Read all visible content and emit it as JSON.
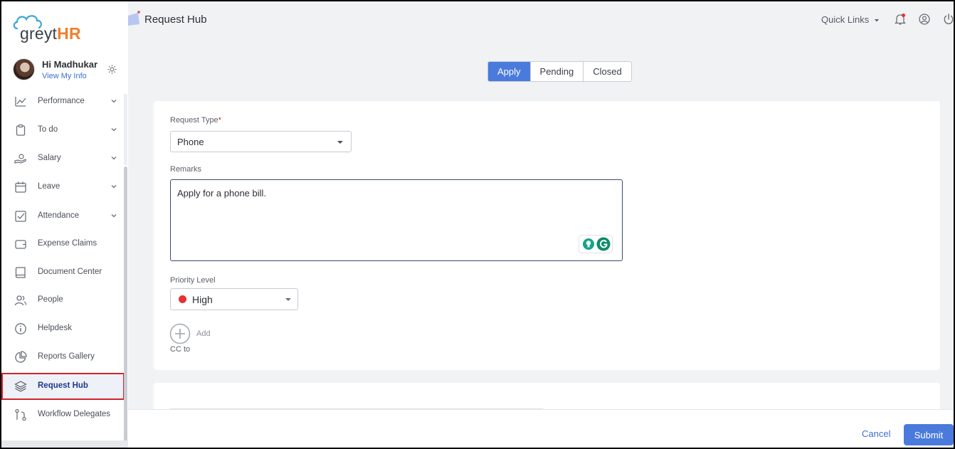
{
  "brand": {
    "logo_prefix": "greyt",
    "logo_suffix": "HR",
    "accent": "#f07f2c"
  },
  "user": {
    "greeting": "Hi Madhukar",
    "link": "View My Info"
  },
  "sidebar": {
    "items": [
      {
        "label": "Performance",
        "icon": "chart-line-icon",
        "expandable": true
      },
      {
        "label": "To do",
        "icon": "clipboard-icon",
        "expandable": true
      },
      {
        "label": "Salary",
        "icon": "hand-money-icon",
        "expandable": true
      },
      {
        "label": "Leave",
        "icon": "calendar-icon",
        "expandable": true
      },
      {
        "label": "Attendance",
        "icon": "checkbox-icon",
        "expandable": true
      },
      {
        "label": "Expense Claims",
        "icon": "wallet-icon",
        "expandable": false
      },
      {
        "label": "Document Center",
        "icon": "book-icon",
        "expandable": false
      },
      {
        "label": "People",
        "icon": "people-icon",
        "expandable": false
      },
      {
        "label": "Helpdesk",
        "icon": "info-icon",
        "expandable": false
      },
      {
        "label": "Reports Gallery",
        "icon": "pie-chart-icon",
        "expandable": false
      },
      {
        "label": "Request Hub",
        "icon": "layers-icon",
        "expandable": false,
        "active": true
      },
      {
        "label": "Workflow Delegates",
        "icon": "workflow-icon",
        "expandable": false
      }
    ]
  },
  "header": {
    "title": "Request Hub",
    "quick_links": "Quick Links"
  },
  "tabs": [
    {
      "label": "Apply",
      "selected": true
    },
    {
      "label": "Pending",
      "selected": false
    },
    {
      "label": "Closed",
      "selected": false
    }
  ],
  "form": {
    "request_type_label": "Request Type",
    "request_type_required": "*",
    "request_type_value": "Phone",
    "remarks_label": "Remarks",
    "remarks_value": "Apply for a phone bill.",
    "priority_label": "Priority Level",
    "priority_value": "High",
    "priority_color": "#e53232",
    "add_label": "Add",
    "cc_label": "CC to"
  },
  "footer": {
    "cancel_label": "Cancel",
    "submit_label": "Submit"
  },
  "colors": {
    "primary": "#4a7bdc",
    "active_border": "#d2232a"
  }
}
